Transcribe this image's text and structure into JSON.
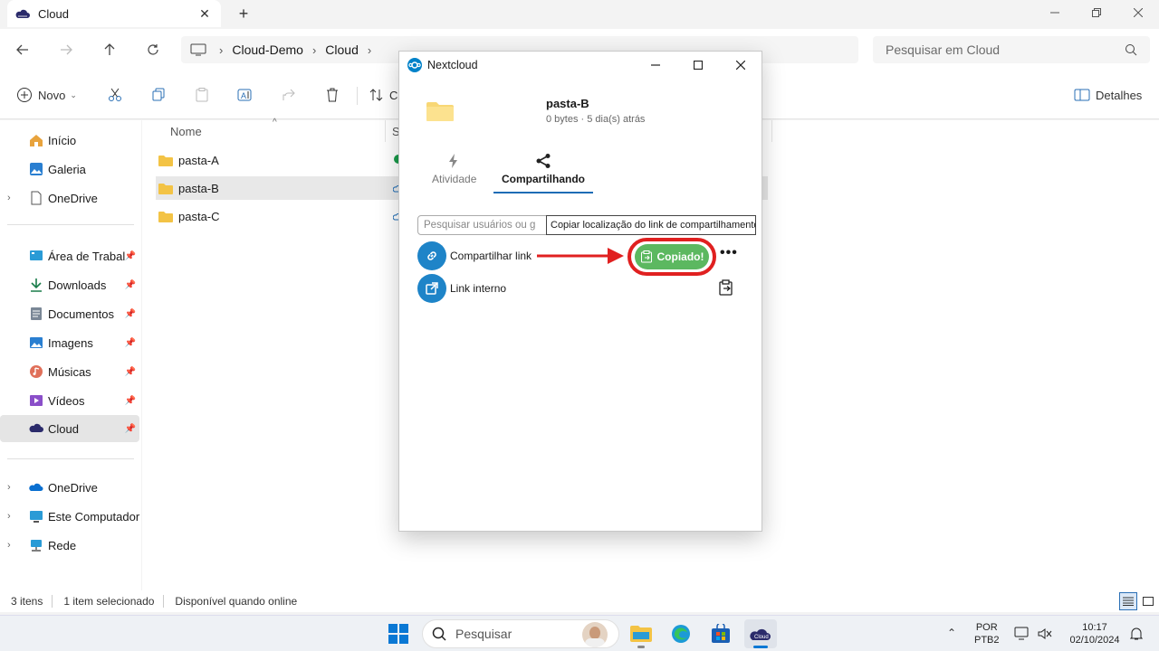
{
  "window": {
    "tab_title": "Cloud",
    "tab_close": "✕",
    "new_tab": "+"
  },
  "address": {
    "crumbs": [
      "Cloud-Demo",
      "Cloud"
    ],
    "search_placeholder": "Pesquisar em Cloud"
  },
  "toolbar": {
    "new_label": "Novo",
    "sort_label": "C",
    "details_label": "Detalhes"
  },
  "sidebar": {
    "items": [
      {
        "label": "Início",
        "icon": "home-icon"
      },
      {
        "label": "Galeria",
        "icon": "gallery-icon"
      },
      {
        "label": "OneDrive",
        "icon": "onedrive-icon"
      },
      {
        "label": "Área de Trabalho",
        "icon": "desktop-icon"
      },
      {
        "label": "Downloads",
        "icon": "download-icon"
      },
      {
        "label": "Documentos",
        "icon": "documents-icon"
      },
      {
        "label": "Imagens",
        "icon": "images-icon"
      },
      {
        "label": "Músicas",
        "icon": "music-icon"
      },
      {
        "label": "Vídeos",
        "icon": "videos-icon"
      },
      {
        "label": "Cloud",
        "icon": "cloud-icon"
      },
      {
        "label": "OneDrive",
        "icon": "onedrive-icon"
      },
      {
        "label": "Este Computador",
        "icon": "computer-icon"
      },
      {
        "label": "Rede",
        "icon": "network-icon"
      }
    ]
  },
  "files": {
    "column_name": "Nome",
    "column_status": "S",
    "rows": [
      {
        "name": "pasta-A"
      },
      {
        "name": "pasta-B"
      },
      {
        "name": "pasta-C"
      }
    ]
  },
  "status": {
    "count": "3 itens",
    "selected": "1 item selecionado",
    "availability": "Disponível quando online"
  },
  "taskbar": {
    "search_label": "Pesquisar",
    "lang_top": "POR",
    "lang_bottom": "PTB2",
    "time": "10:17",
    "date": "02/10/2024"
  },
  "nextcloud": {
    "title": "Nextcloud",
    "folder_name": "pasta-B",
    "folder_meta": "0 bytes · 5 dia(s) atrás",
    "tab_activity": "Atividade",
    "tab_sharing": "Compartilhando",
    "search_placeholder": "Pesquisar usuários ou g",
    "tooltip": "Copiar localização do link de compartilhamento",
    "share_link_label": "Compartilhar link",
    "copied_label": "Copiado!",
    "internal_link_label": "Link interno",
    "colors": {
      "accent": "#1e84c8",
      "copied_green": "#5cb860",
      "highlight_red": "#e02020"
    }
  }
}
